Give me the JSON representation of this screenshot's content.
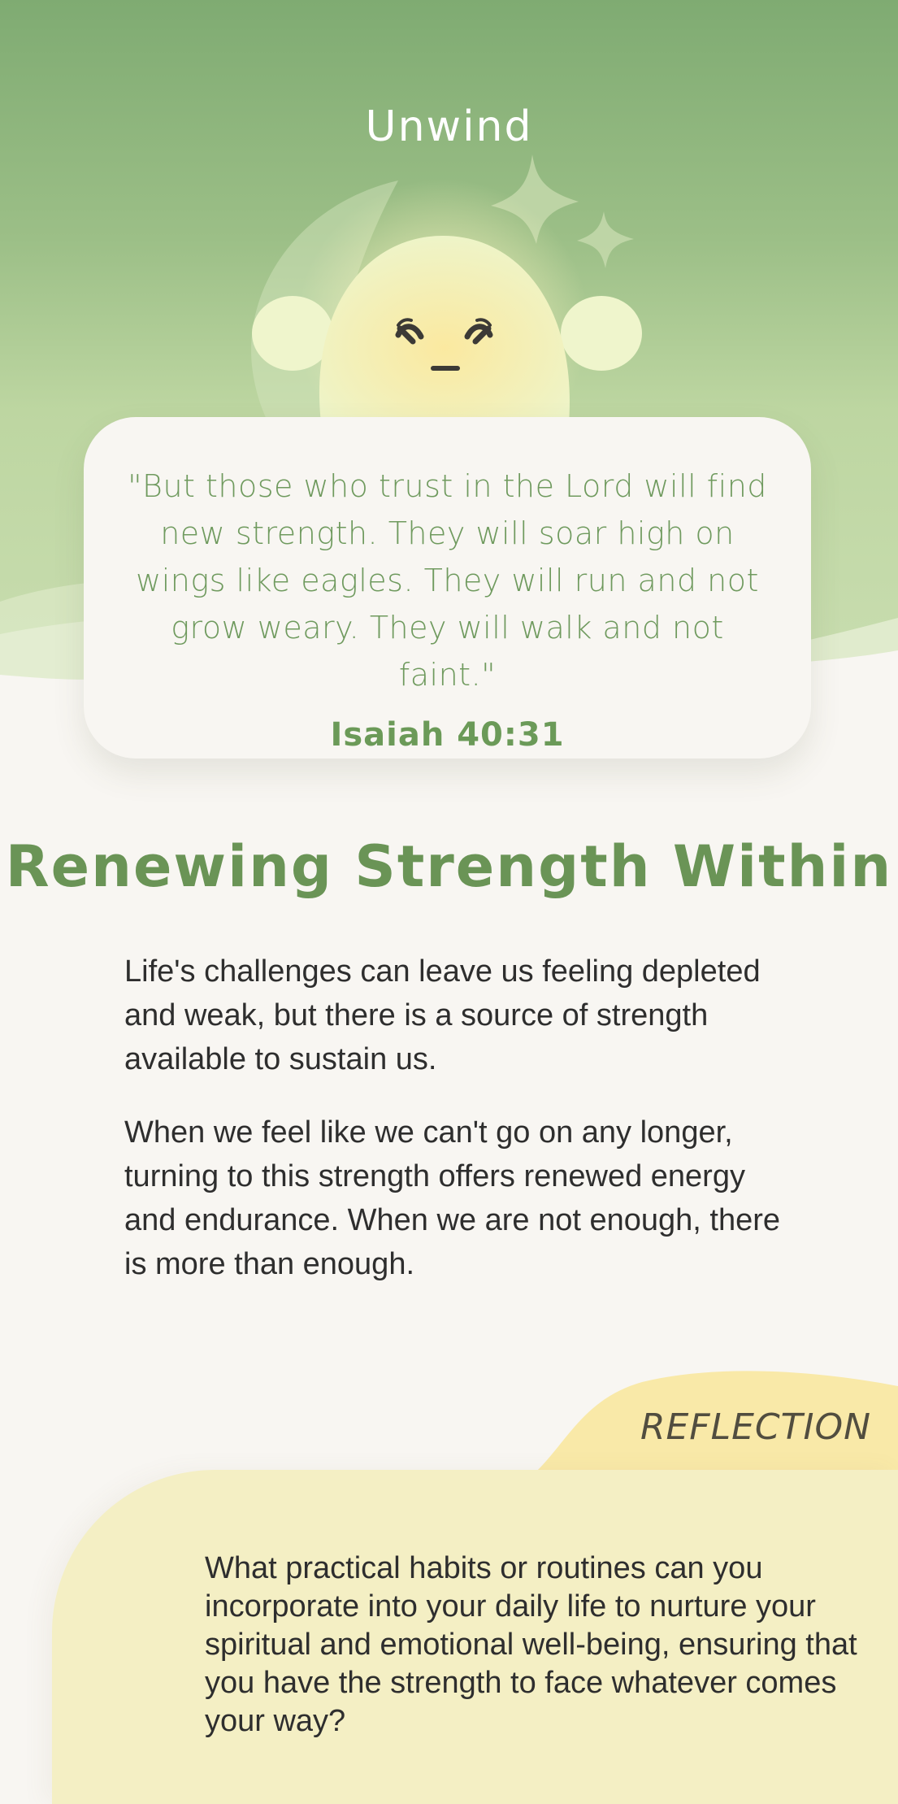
{
  "header": {
    "title": "Unwind"
  },
  "verse": {
    "quote": "\"But those who trust in the Lord will find new strength. They will soar high on wings like eagles. They will run and not grow weary. They will walk and not faint.\"",
    "reference": "Isaiah 40:31"
  },
  "article": {
    "heading": "Renewing Strength Within",
    "paragraphs": [
      "Life's challenges can leave us feeling depleted and weak, but there is a source of strength available to sustain us.",
      "When we feel like we can't go on any longer, turning to this strength offers renewed energy and endurance. When we are not enough, there is more than enough."
    ]
  },
  "reflection": {
    "label": "REFLECTION",
    "question": "What practical habits or routines can you incorporate into your daily life to nurture your spiritual and emotional well-being, ensuring that you have the strength to face whatever comes your way?"
  },
  "colors": {
    "hero_green": "#7fab72",
    "accent_green": "#6a9456",
    "background": "#f8f6f2",
    "reflection_yellow": "#f4efc4",
    "reflection_tab": "#f9e9a8"
  },
  "icons": {
    "mascot": "sleepy-sun-mascot",
    "moon": "crescent-moon-icon",
    "stars": "sparkle-star-icon"
  }
}
